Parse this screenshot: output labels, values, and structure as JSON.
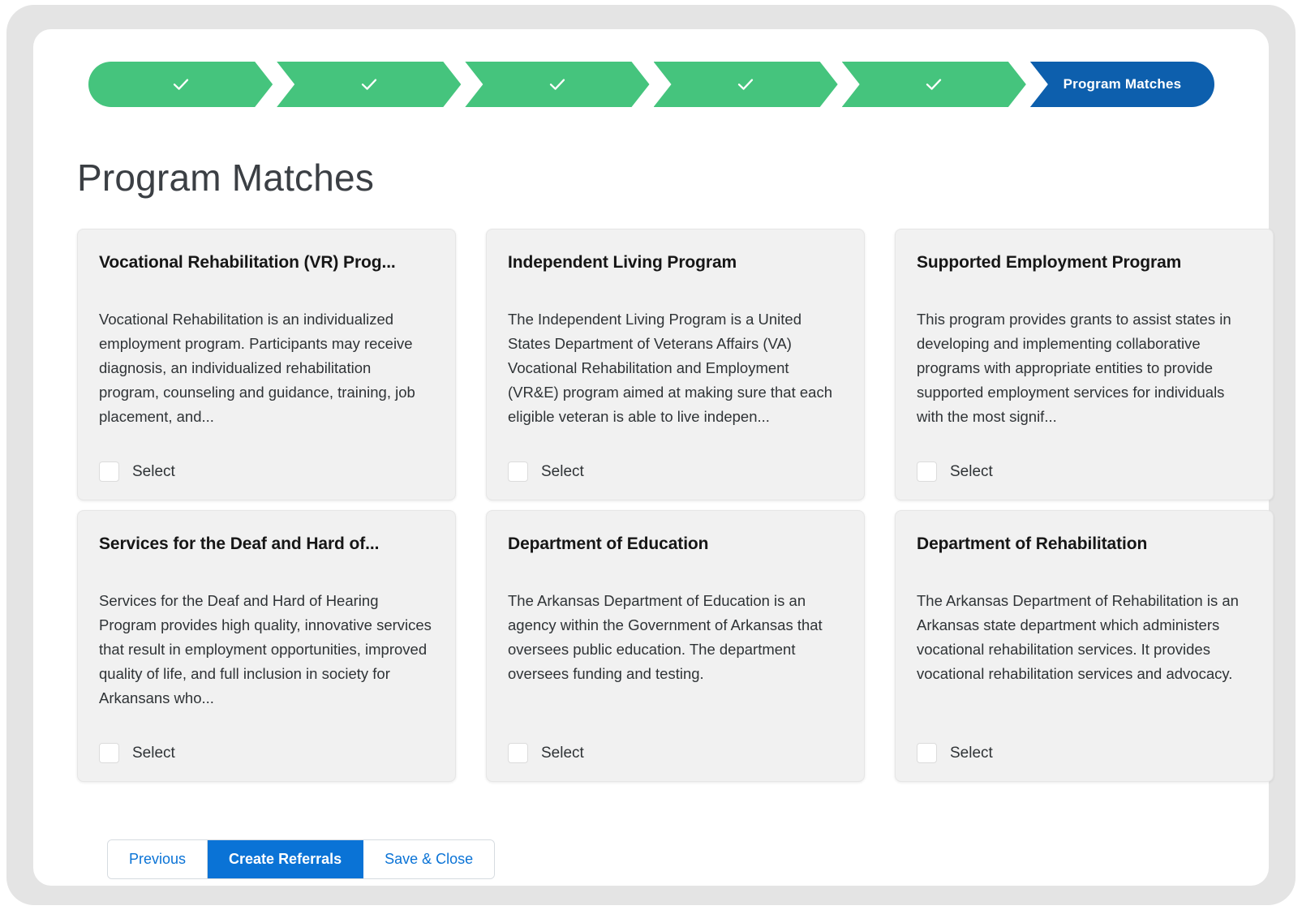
{
  "progress": {
    "steps": [
      {
        "label": "",
        "state": "completed",
        "icon": "check-icon"
      },
      {
        "label": "",
        "state": "completed",
        "icon": "check-icon"
      },
      {
        "label": "",
        "state": "completed",
        "icon": "check-icon"
      },
      {
        "label": "",
        "state": "completed",
        "icon": "check-icon"
      },
      {
        "label": "",
        "state": "completed",
        "icon": "check-icon"
      },
      {
        "label": "Program Matches",
        "state": "active",
        "icon": ""
      }
    ],
    "completed_color": "#45c47d",
    "active_color": "#0d5fad"
  },
  "heading": {
    "title": "Program Matches"
  },
  "cards": [
    {
      "title": "Vocational Rehabilitation (VR) Prog...",
      "description": "Vocational Rehabilitation is an individualized employment program. Participants may receive diagnosis, an individualized rehabilitation program, counseling and guidance, training, job placement, and...",
      "select_label": "Select",
      "checked": false
    },
    {
      "title": "Independent Living Program",
      "description": "The Independent Living Program is a United States Department of Veterans Affairs (VA) Vocational Rehabilitation and Employment (VR&E) program aimed at making sure that each eligible veteran is able to live indepen...",
      "select_label": "Select",
      "checked": false
    },
    {
      "title": "Supported Employment Program",
      "description": "This program provides grants to assist states in developing and implementing collaborative programs with appropriate entities to provide supported employment services for individuals with the most signif...",
      "select_label": "Select",
      "checked": false
    },
    {
      "title": "Services for the Deaf and Hard of...",
      "description": "Services for the Deaf and Hard of Hearing Program provides high quality, innovative services that result in employment opportunities, improved quality of life, and full inclusion in society for Arkansans who...",
      "select_label": "Select",
      "checked": false
    },
    {
      "title": "Department of Education",
      "description": "The Arkansas Department of Education is an agency within the Government of Arkansas that oversees public education. The department oversees funding and testing.",
      "select_label": "Select",
      "checked": false
    },
    {
      "title": "Department of Rehabilitation",
      "description": "The Arkansas Department of Rehabilitation is an Arkansas state department which administers vocational rehabilitation services. It provides vocational rehabilitation services and advocacy.",
      "select_label": "Select",
      "checked": false
    }
  ],
  "footer": {
    "previous_label": "Previous",
    "create_referrals_label": "Create Referrals",
    "save_close_label": "Save & Close",
    "primary_color": "#0a73d6"
  }
}
